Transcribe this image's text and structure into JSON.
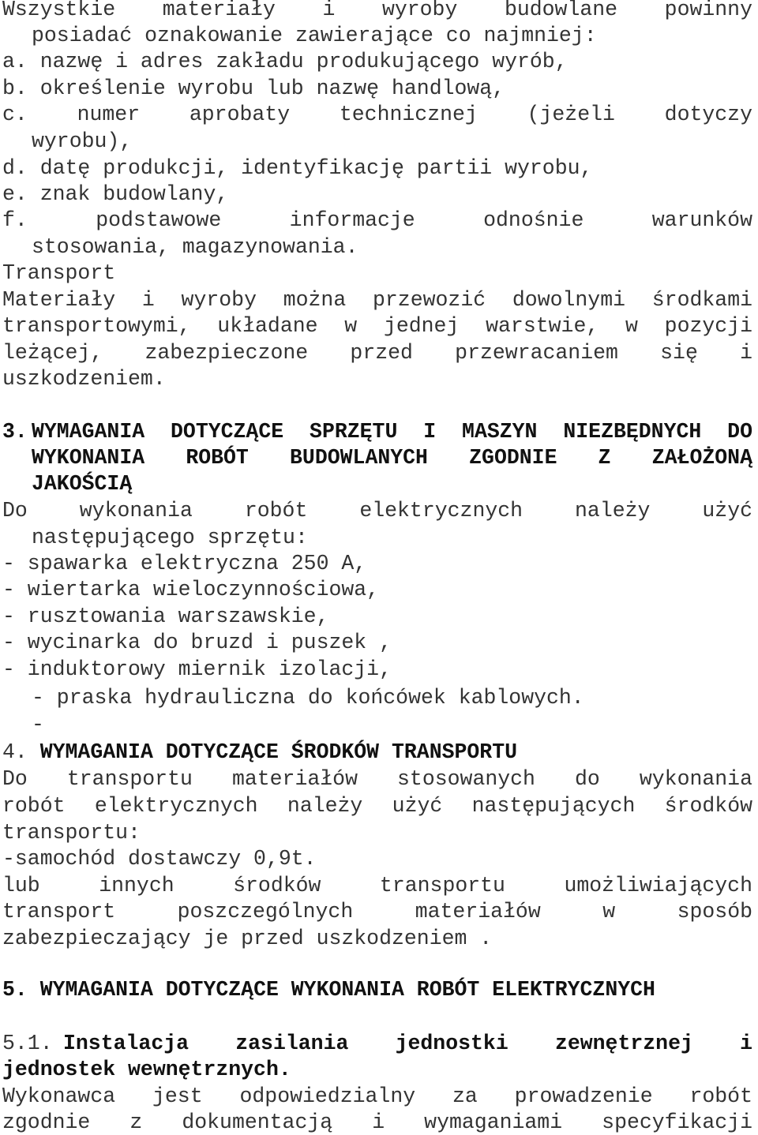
{
  "document": {
    "intro": {
      "line1": "Wszystkie materiały i wyroby budowlane powinny",
      "line2": "posiadać oznakowanie zawierające co najmniej:",
      "items": [
        "a. nazwę i adres zakładu produkującego wyrób,",
        "b. określenie wyrobu lub nazwę handlową,",
        "c. numer aprobaty technicznej (jeżeli dotyczy",
        "wyrobu),",
        "d. datę produkcji, identyfikację partii wyrobu,",
        "e. znak budowlany,",
        "f. podstawowe informacje odnośnie warunków",
        "stosowania, magazynowania."
      ]
    },
    "transport": {
      "heading": "Transport",
      "lines": [
        "Materiały i wyroby można przewozić dowolnymi środkami",
        "transportowymi, układane w jednej warstwie, w pozycji",
        "leżącej, zabezpieczone przed przewracaniem się i",
        "uszkodzeniem."
      ]
    },
    "section3": {
      "number": "3.",
      "heading_lines": [
        "WYMAGANIA DOTYCZĄCE SPRZĘTU I MASZYN NIEZBĘDNYCH DO",
        "WYKONANIA ROBÓT BUDOWLANYCH ZGODNIE Z ZAŁOŻONĄ",
        "JAKOŚCIĄ"
      ],
      "intro_lines": [
        "Do wykonania robót elektrycznych należy użyć",
        "następującego sprzętu:"
      ],
      "equipment": [
        "- spawarka elektryczna 250 A,",
        "- wiertarka wieloczynnościowa,",
        "- rusztowania warszawskie,",
        "- wycinarka do bruzd i puszek ,",
        "- induktorowy miernik izolacji,",
        "- praska hydrauliczna do końcówek kablowych.",
        "-"
      ]
    },
    "section4": {
      "number": "4.",
      "heading": "WYMAGANIA DOTYCZĄCE ŚRODKÓW TRANSPORTU",
      "lines": [
        "Do transportu materiałów stosowanych do wykonania",
        "robót elektrycznych należy użyć następujących środków",
        "transportu:",
        "-samochód dostawczy 0,9t.",
        "lub innych środków transportu umożliwiających",
        "transport poszczególnych materiałów w sposób",
        "zabezpieczający je przed uszkodzeniem ."
      ]
    },
    "section5": {
      "number": "5.",
      "heading": "WYMAGANIA DOTYCZĄCE WYKONANIA ROBÓT ELEKTRYCZNYCH",
      "sub": {
        "number": "5.1.",
        "heading_line1": "Instalacja zasilania jednostki zewnętrznej i",
        "heading_line2": "jednostek wewnętrznych.",
        "lines": [
          "Wykonawca jest odpowiedzialny za prowadzenie robót",
          "zgodnie z dokumentacją i wymaganiami specyfikacji"
        ]
      }
    }
  }
}
